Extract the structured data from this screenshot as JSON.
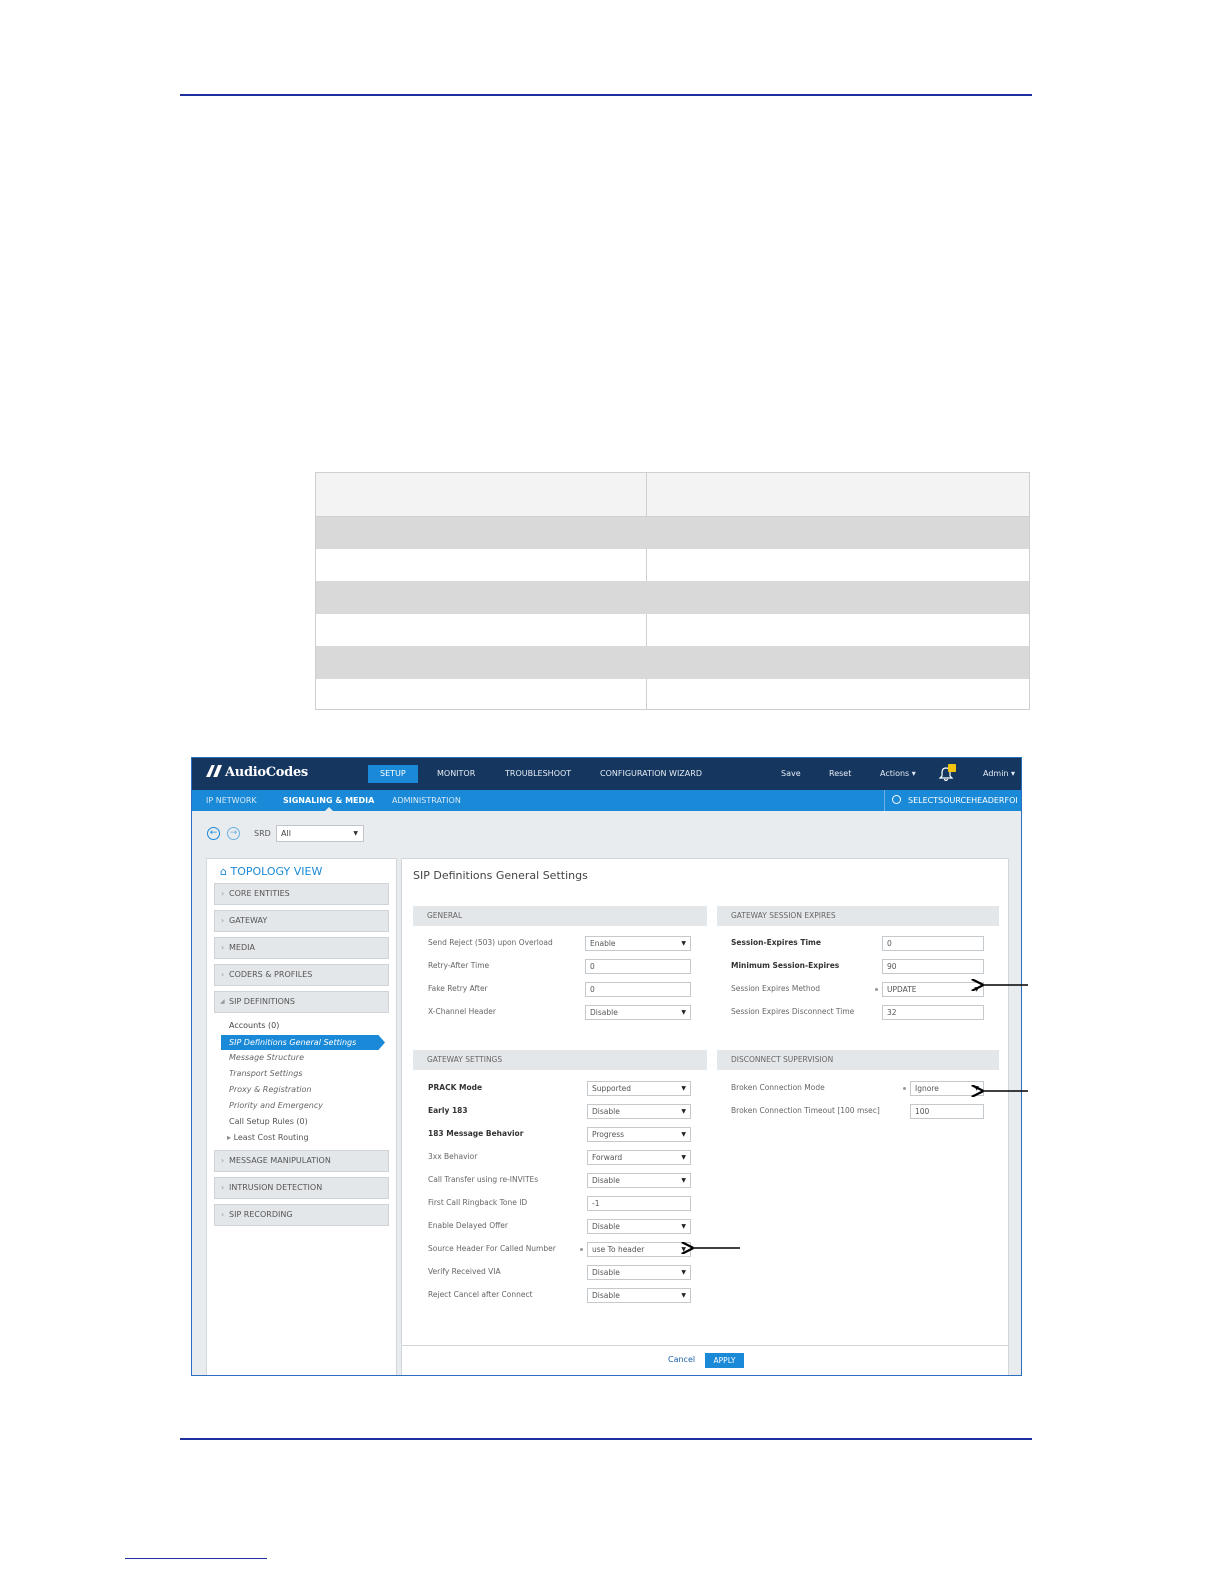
{
  "app": {
    "logo": "AudioCodes",
    "top_nav": [
      "SETUP",
      "MONITOR",
      "TROUBLESHOOT",
      "CONFIGURATION WIZARD"
    ],
    "top_actions": {
      "save": "Save",
      "reset": "Reset",
      "actions": "Actions ▾",
      "admin": "Admin ▾"
    },
    "sub_nav": [
      "IP NETWORK",
      "SIGNALING & MEDIA",
      "ADMINISTRATION"
    ],
    "search_text": "SELECTSOURCEHEADERFOI",
    "srd_label": "SRD",
    "srd_value": "All",
    "topology_title": "TOPOLOGY VIEW",
    "accordions_top": [
      "CORE ENTITIES",
      "GATEWAY",
      "MEDIA",
      "CODERS & PROFILES",
      "SIP DEFINITIONS"
    ],
    "sip_items": [
      "Accounts (0)",
      "SIP Definitions General Settings",
      "Message Structure",
      "Transport Settings",
      "Proxy & Registration",
      "Priority and Emergency",
      "Call Setup Rules (0)",
      "Least Cost Routing"
    ],
    "accordions_bottom": [
      "MESSAGE MANIPULATION",
      "INTRUSION DETECTION",
      "SIP RECORDING"
    ],
    "page_title": "SIP Definitions General Settings",
    "general": {
      "title": "GENERAL",
      "fields": [
        {
          "label": "Send Reject (503) upon Overload",
          "value": "Enable",
          "type": "select"
        },
        {
          "label": "Retry-After Time",
          "value": "0",
          "type": "text"
        },
        {
          "label": "Fake Retry After",
          "value": "0",
          "type": "text"
        },
        {
          "label": "X-Channel Header",
          "value": "Disable",
          "type": "select"
        }
      ]
    },
    "session_expires": {
      "title": "GATEWAY SESSION EXPIRES",
      "fields": [
        {
          "label": "Session-Expires Time",
          "value": "0",
          "type": "text"
        },
        {
          "label": "Minimum Session-Expires",
          "value": "90",
          "type": "text"
        },
        {
          "label": "Session Expires Method",
          "value": "UPDATE",
          "type": "select"
        },
        {
          "label": "Session Expires Disconnect Time",
          "value": "32",
          "type": "text"
        }
      ]
    },
    "gateway_settings": {
      "title": "GATEWAY SETTINGS",
      "fields": [
        {
          "label": "PRACK Mode",
          "value": "Supported",
          "type": "select"
        },
        {
          "label": "Early 183",
          "value": "Disable",
          "type": "select"
        },
        {
          "label": "183 Message Behavior",
          "value": "Progress",
          "type": "select"
        },
        {
          "label": "3xx Behavior",
          "value": "Forward",
          "type": "select"
        },
        {
          "label": "Call Transfer using re-INVITEs",
          "value": "Disable",
          "type": "select"
        },
        {
          "label": "First Call Ringback Tone ID",
          "value": "-1",
          "type": "text"
        },
        {
          "label": "Enable Delayed Offer",
          "value": "Disable",
          "type": "select"
        },
        {
          "label": "Source Header For Called Number",
          "value": "use To header",
          "type": "select"
        },
        {
          "label": "Verify Received VIA",
          "value": "Disable",
          "type": "select"
        },
        {
          "label": "Reject Cancel after Connect",
          "value": "Disable",
          "type": "select"
        }
      ]
    },
    "disconnect": {
      "title": "DISCONNECT SUPERVISION",
      "fields": [
        {
          "label": "Broken Connection Mode",
          "value": "Ignore",
          "type": "select"
        },
        {
          "label": "Broken Connection Timeout [100 msec]",
          "value": "100",
          "type": "text"
        }
      ]
    },
    "footer": {
      "cancel": "Cancel",
      "apply": "APPLY"
    }
  },
  "colors": {
    "header_bg": "#15365f",
    "accent": "#1a8ad8",
    "rule": "#1f2f9e"
  }
}
